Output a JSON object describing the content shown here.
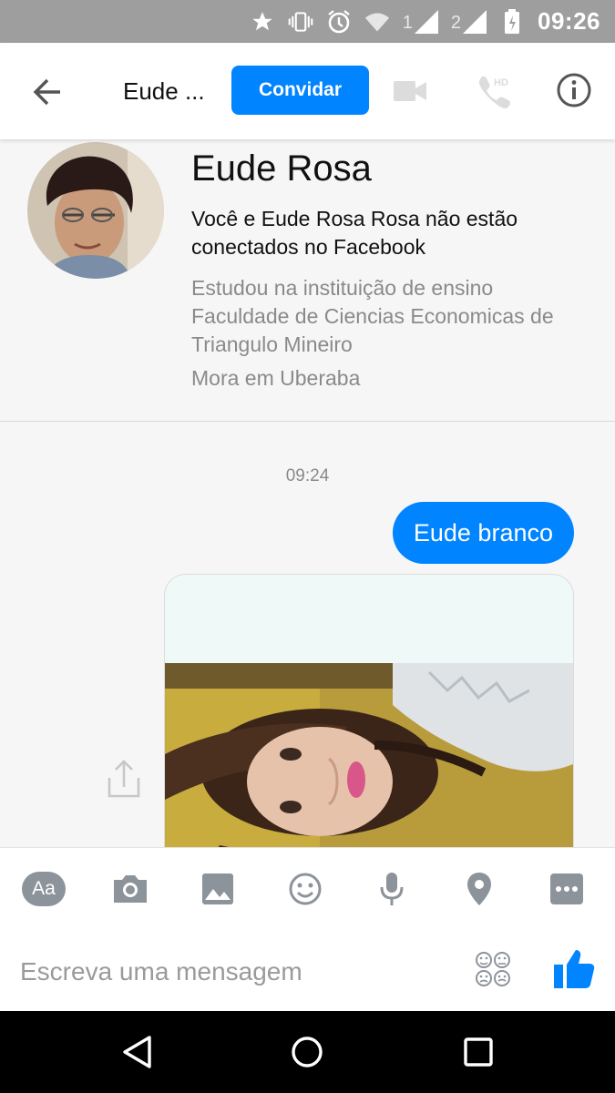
{
  "status_bar": {
    "time": "09:26",
    "sim1": "1",
    "sim2": "2",
    "icons": [
      "star-icon",
      "vibrate-icon",
      "alarm-icon",
      "wifi-icon",
      "signal-icon",
      "battery-icon"
    ]
  },
  "toolbar": {
    "title": "Eude ...",
    "invite_label": "Convidar",
    "icons": [
      "back-arrow-icon",
      "video-call-icon",
      "hd-call-icon",
      "info-icon"
    ],
    "accent": "#0084ff"
  },
  "profile": {
    "name": "Eude Rosa",
    "connection_text": "Você e Eude Rosa Rosa não estão conectados no Facebook",
    "study_text": "Estudou na instituição de ensino Faculdade de Ciencias Economicas de Triangulo Mineiro",
    "lives_text": "Mora em Uberaba"
  },
  "chat": {
    "timestamp": "09:24",
    "messages": [
      {
        "type": "text",
        "sender": "me",
        "text": "Eude branco"
      },
      {
        "type": "image",
        "sender": "me"
      }
    ],
    "bubble_color": "#0084ff"
  },
  "composer": {
    "placeholder": "Escreva uma mensagem",
    "aa_label": "Aa",
    "icons": [
      "text-format-icon",
      "camera-icon",
      "gallery-icon",
      "emoji-icon",
      "microphone-icon",
      "location-icon",
      "more-icon",
      "stickers-icon",
      "like-icon"
    ]
  },
  "nav_bar": {
    "icons": [
      "back-triangle-icon",
      "home-circle-icon",
      "recents-square-icon"
    ]
  }
}
